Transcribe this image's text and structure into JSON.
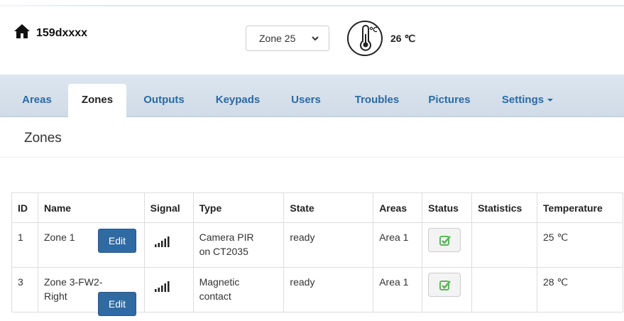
{
  "header": {
    "device_name": "159dxxxx",
    "zone_select": {
      "selected": "Zone 25"
    },
    "temperature": "26 ℃"
  },
  "nav": {
    "tabs": [
      {
        "label": "Areas",
        "active": false
      },
      {
        "label": "Zones",
        "active": true
      },
      {
        "label": "Outputs",
        "active": false
      },
      {
        "label": "Keypads",
        "active": false
      },
      {
        "label": "Users",
        "active": false
      },
      {
        "label": "Troubles",
        "active": false
      },
      {
        "label": "Pictures",
        "active": false
      },
      {
        "label": "Settings",
        "active": false,
        "dropdown": true
      }
    ]
  },
  "page": {
    "title": "Zones"
  },
  "table": {
    "columns": [
      "ID",
      "Name",
      "Signal",
      "Type",
      "State",
      "Areas",
      "Status",
      "Statistics",
      "Temperature"
    ],
    "edit_label": "Edit",
    "rows": [
      {
        "id": "1",
        "name": "Zone 1",
        "signal_icon": "signal-bars-icon",
        "type_line1": "Camera PIR",
        "type_line2": "on CT2035",
        "state": "ready",
        "areas": "Area 1",
        "status_icon": "check-square-icon",
        "statistics": "",
        "temperature": "25 ℃"
      },
      {
        "id": "3",
        "name_line1": "Zone 3-FW2-",
        "name_line2": "Right",
        "signal_icon": "signal-bars-icon",
        "type_line1": "Magnetic",
        "type_line2": "contact",
        "state": "ready",
        "areas": "Area 1",
        "status_icon": "check-square-icon",
        "statistics": "",
        "temperature": "28 ℃"
      }
    ]
  },
  "colors": {
    "link": "#2a6aa5",
    "edit_button": "#2f6aa3",
    "status_check": "#5cb85c",
    "navbar": "#d6e0ea"
  }
}
